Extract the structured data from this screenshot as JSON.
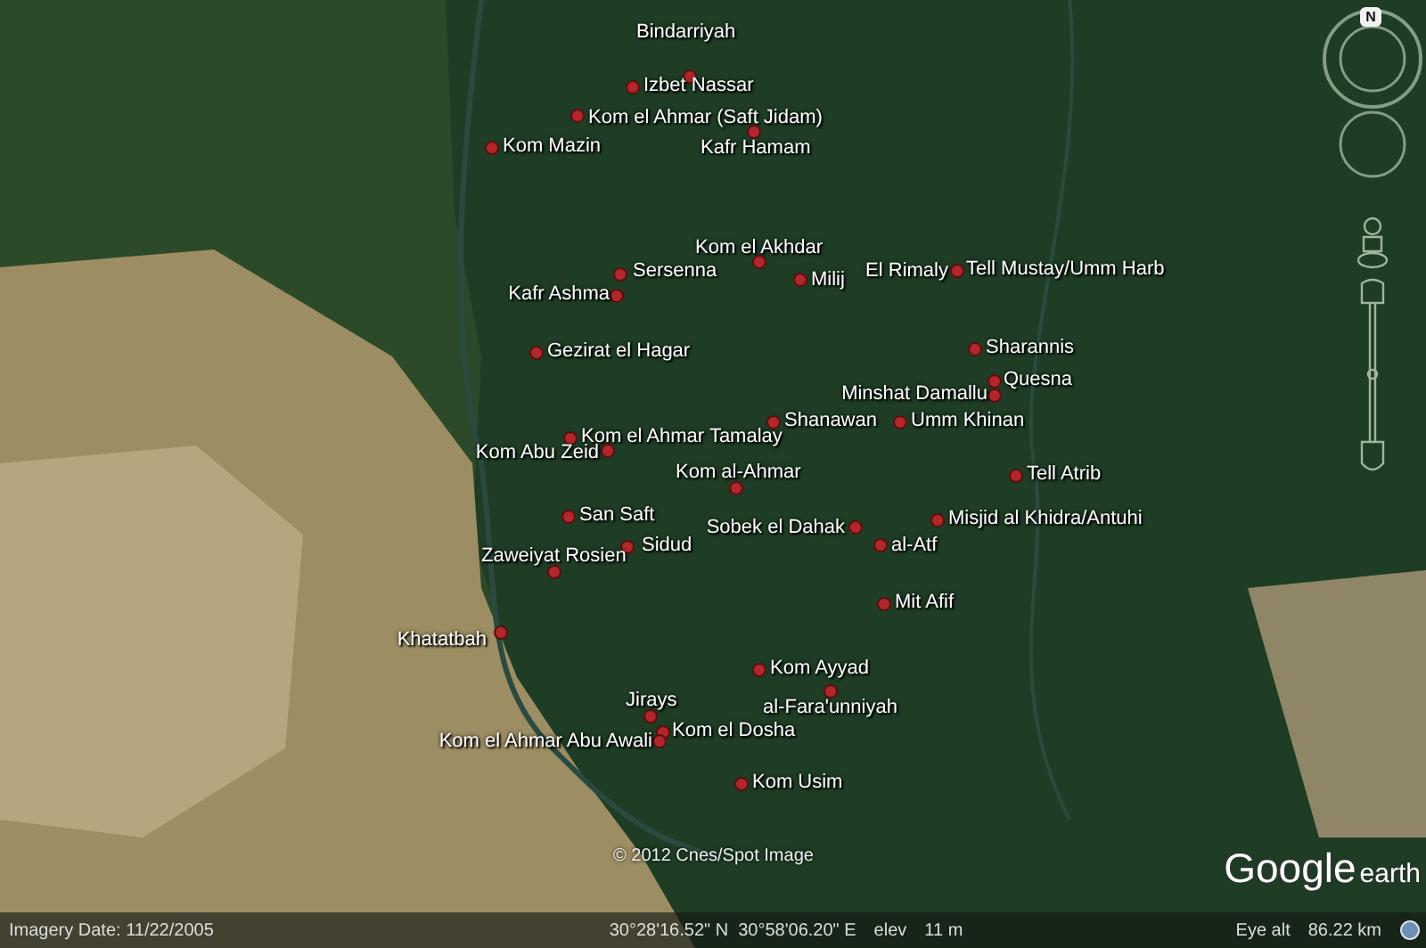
{
  "places": [
    {
      "name": "Bindarriyah"
    },
    {
      "name": "Izbet Nassar"
    },
    {
      "name": "Kom el Ahmar (Saft Jidam)"
    },
    {
      "name": "Kafr Hamam"
    },
    {
      "name": "Kom Mazin"
    },
    {
      "name": "Kom el Akhdar"
    },
    {
      "name": "Sersenna"
    },
    {
      "name": "Milij"
    },
    {
      "name": "Kafr Ashma"
    },
    {
      "name": "El Rimaly"
    },
    {
      "name": "Tell Mustay/Umm Harb"
    },
    {
      "name": "Gezirat el Hagar"
    },
    {
      "name": "Sharannis"
    },
    {
      "name": "Quesna"
    },
    {
      "name": "Minshat Damallu"
    },
    {
      "name": "Shanawan"
    },
    {
      "name": "Umm Khinan"
    },
    {
      "name": "Kom el Ahmar Tamalay"
    },
    {
      "name": "Kom Abu Zeid"
    },
    {
      "name": "Kom al-Ahmar"
    },
    {
      "name": "Tell Atrib"
    },
    {
      "name": "San Saft"
    },
    {
      "name": "Sobek el Dahak"
    },
    {
      "name": "Misjid al Khidra/Antuhi"
    },
    {
      "name": "Sidud"
    },
    {
      "name": "al-Atf"
    },
    {
      "name": "Zaweiyat Rosien"
    },
    {
      "name": "Mit Afif"
    },
    {
      "name": "Khatatbah"
    },
    {
      "name": "Kom Ayyad"
    },
    {
      "name": "Jirays"
    },
    {
      "name": "al-Fara'unniyah"
    },
    {
      "name": "Kom el Dosha"
    },
    {
      "name": "Kom el Ahmar Abu Awali"
    },
    {
      "name": "Kom Usim"
    }
  ],
  "compass": {
    "north": "N"
  },
  "copyright": "© 2012 Cnes/Spot Image",
  "logo": {
    "brand": "Google",
    "product": "earth"
  },
  "status_bar": {
    "imagery_date": "Imagery Date: 11/22/2005",
    "coordinates": "30°28'16.52\" N  30°58'06.20\" E",
    "elev_label": "elev",
    "elev_value": "11 m",
    "eye_alt_label": "Eye alt",
    "eye_alt_value": "86.22 km"
  }
}
